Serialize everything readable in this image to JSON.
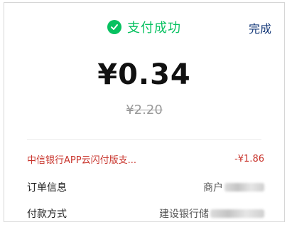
{
  "header": {
    "status_text": "支付成功",
    "done_label": "完成",
    "status_color": "#07c160"
  },
  "payment": {
    "amount": "¥0.34",
    "original_amount": "¥2.20"
  },
  "details": {
    "discount_label": "中信银行APP云闪付版支...",
    "discount_value": "-¥1.86",
    "order_label": "订单信息",
    "order_value": "商户",
    "method_label": "付款方式",
    "method_value": "建设银行储"
  },
  "colors": {
    "accent_green": "#07c160",
    "discount_red": "#c8332b",
    "link_blue": "#163a7a"
  }
}
